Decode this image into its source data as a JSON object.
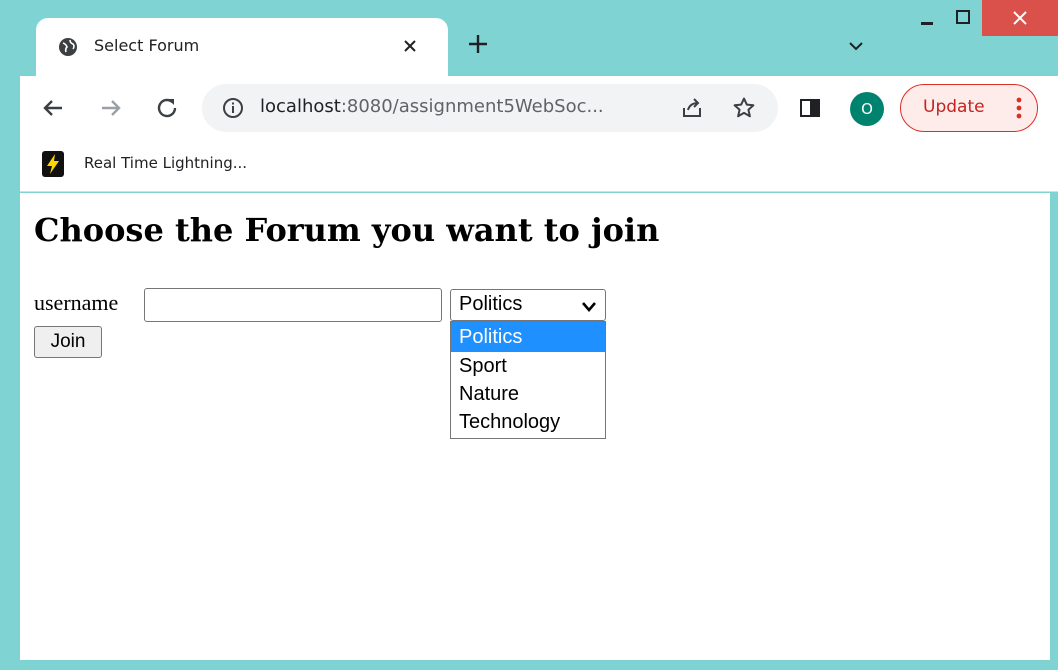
{
  "tab": {
    "title": "Select Forum"
  },
  "omnibox": {
    "host": "localhost",
    "path": ":8080/assignment5WebSoc..."
  },
  "profile": {
    "initial": "O"
  },
  "update": {
    "label": "Update"
  },
  "bookmarks": [
    {
      "label": "Real Time Lightning..."
    }
  ],
  "page": {
    "heading": "Choose the Forum you want to join",
    "username_label": "username",
    "username_value": "",
    "forum_select": {
      "selected": "Politics",
      "options": [
        "Politics",
        "Sport",
        "Nature",
        "Technology"
      ]
    },
    "join_label": "Join"
  },
  "colors": {
    "window_frame": "#80d3d3",
    "close_button": "#d9514a",
    "avatar": "#00836e",
    "update_accent": "#d93025",
    "option_highlight": "#1e90ff"
  },
  "icons": [
    "globe-icon",
    "close-icon",
    "plus-icon",
    "chevron-down-icon",
    "back-arrow-icon",
    "forward-arrow-icon",
    "reload-icon",
    "info-icon",
    "share-icon",
    "star-icon",
    "side-panel-icon",
    "kebab-menu-icon",
    "lightning-icon"
  ]
}
